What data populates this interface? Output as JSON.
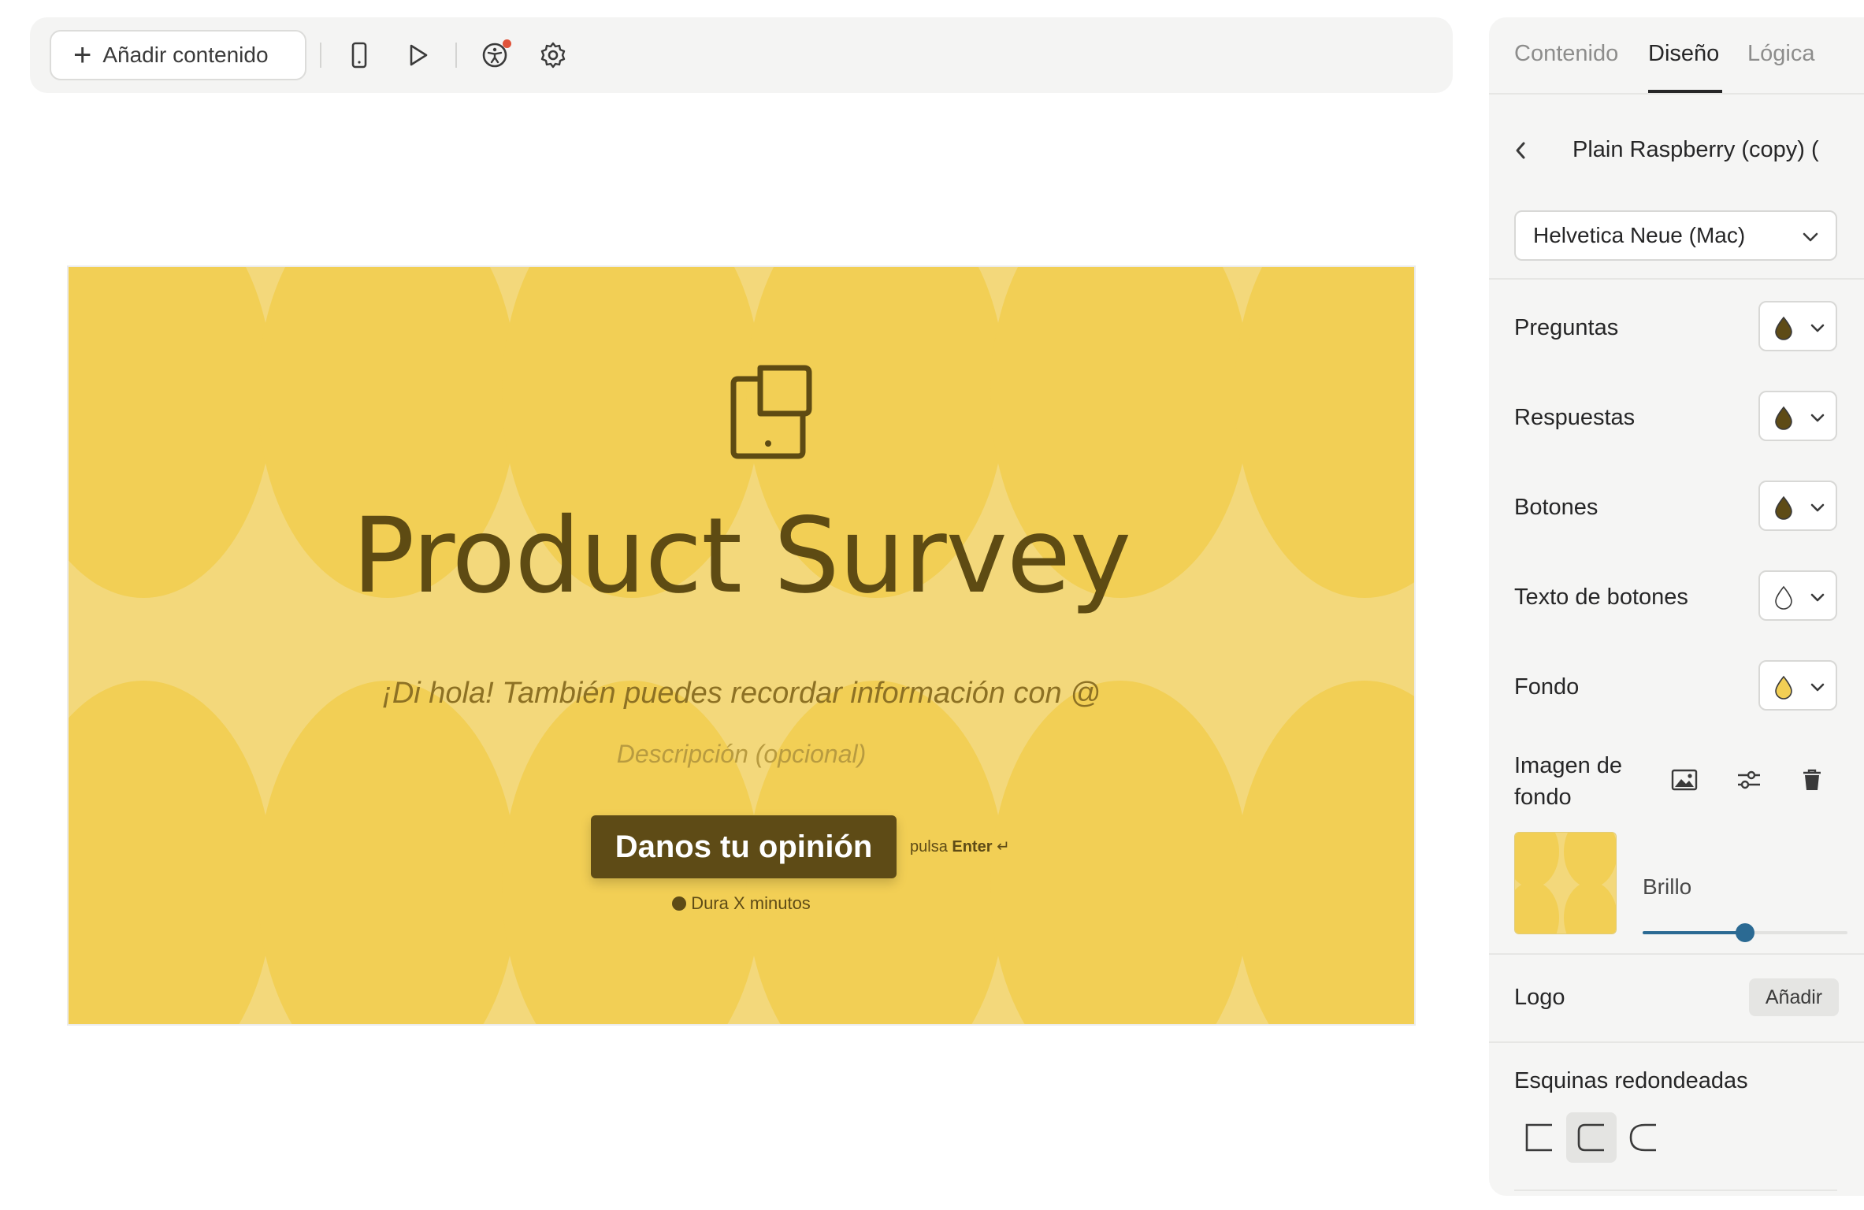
{
  "toolbar": {
    "add_content_label": "Añadir contenido",
    "icons": [
      "mobile-preview-icon",
      "play-icon",
      "accessibility-icon",
      "settings-icon"
    ]
  },
  "preview": {
    "title": "Product Survey",
    "subtitle": "¡Di hola! También puedes recordar información con @",
    "description_placeholder": "Descripción (opcional)",
    "cta_label": "Danos tu opinión",
    "enter_hint_prefix": "pulsa",
    "enter_hint_key": "Enter",
    "enter_symbol": "↵",
    "duration": "Dura X minutos",
    "colors": {
      "background": "#f3d87b",
      "shapes": "#f2cf55",
      "text": "#5e4b13",
      "button": "#5e4b16"
    }
  },
  "panel": {
    "tabs": [
      {
        "label": "Contenido",
        "active": false
      },
      {
        "label": "Diseño",
        "active": true
      },
      {
        "label": "Lógica",
        "active": false
      }
    ],
    "theme_name": "Plain Raspberry (copy) (",
    "font_value": "Helvetica Neue (Mac)",
    "color_rows": [
      {
        "label": "Preguntas",
        "swatch": "#5e4b16"
      },
      {
        "label": "Respuestas",
        "swatch": "#5e4b16"
      },
      {
        "label": "Botones",
        "swatch": "#5e4b16"
      },
      {
        "label": "Texto de botones",
        "swatch": "#ffffff"
      },
      {
        "label": "Fondo",
        "swatch": "#f2cf55"
      }
    ],
    "background_image_label": "Imagen de fondo",
    "brightness_label": "Brillo",
    "brightness_value": 0.5,
    "logo_label": "Logo",
    "logo_add_label": "Añadir",
    "corners_label": "Esquinas redondeadas",
    "corners_selected": "rounded"
  }
}
